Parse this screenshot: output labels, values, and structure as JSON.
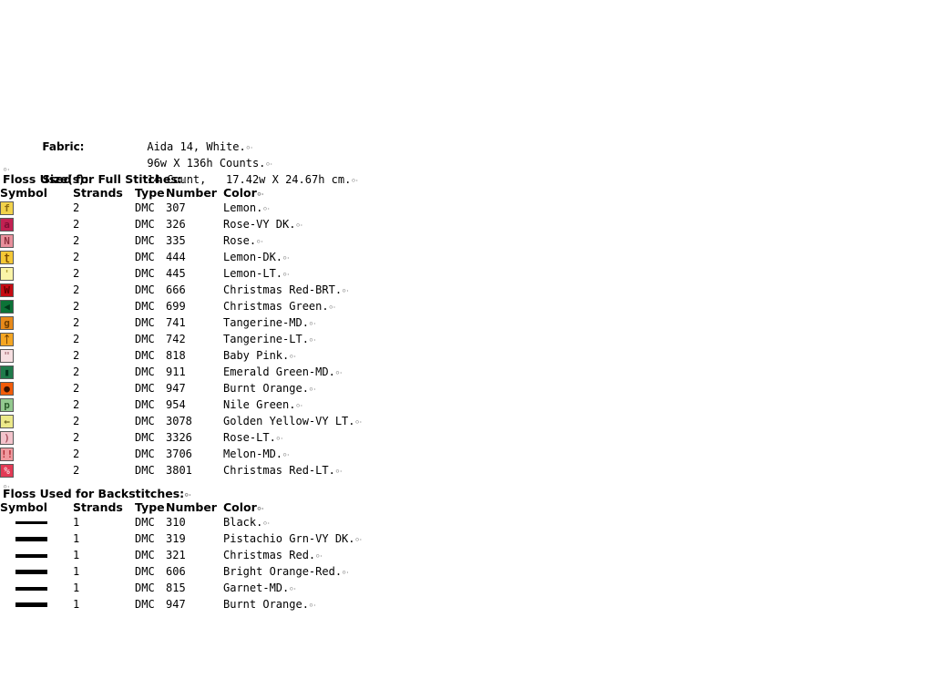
{
  "document": {
    "artifact_mark": "⸰⸱"
  },
  "spec": {
    "rows": [
      {
        "label": "Fabric:",
        "value": "Aida 14, White."
      },
      {
        "label": "",
        "value": "96w X 136h Counts."
      },
      {
        "label": "Size(s):",
        "value": "14 Count,   17.42w X 24.67h cm."
      }
    ]
  },
  "full_stitches": {
    "title": "Floss Used for Full Stitches:",
    "headers": {
      "symbol": "Symbol",
      "strands": "Strands",
      "type": "Type",
      "number": "Number",
      "color": "Color"
    },
    "rows": [
      {
        "glyph": "f",
        "swatch_bg": "#f2d24b",
        "glyph_color": "#8a6a12",
        "strands": "2",
        "type": "DMC",
        "number": "307",
        "color": "Lemon."
      },
      {
        "glyph": "a",
        "swatch_bg": "#c22152",
        "glyph_color": "#7e0e33",
        "strands": "2",
        "type": "DMC",
        "number": "326",
        "color": "Rose-VY DK."
      },
      {
        "glyph": "N",
        "swatch_bg": "#e8909c",
        "glyph_color": "#8c2f3d",
        "strands": "2",
        "type": "DMC",
        "number": "335",
        "color": "Rose."
      },
      {
        "glyph": "ʈ",
        "swatch_bg": "#f5c836",
        "glyph_color": "#7a4a00",
        "strands": "2",
        "type": "DMC",
        "number": "444",
        "color": "Lemon-DK."
      },
      {
        "glyph": "'",
        "swatch_bg": "#fbf5a8",
        "glyph_color": "#b5a23a",
        "strands": "2",
        "type": "DMC",
        "number": "445",
        "color": "Lemon-LT."
      },
      {
        "glyph": "W",
        "swatch_bg": "#c60b13",
        "glyph_color": "#5e0000",
        "strands": "2",
        "type": "DMC",
        "number": "666",
        "color": "Christmas Red-BRT."
      },
      {
        "glyph": "◀",
        "swatch_bg": "#0c7337",
        "glyph_color": "#00391a",
        "strands": "2",
        "type": "DMC",
        "number": "699",
        "color": "Christmas Green."
      },
      {
        "glyph": "g",
        "swatch_bg": "#e88a1a",
        "glyph_color": "#6d3c00",
        "strands": "2",
        "type": "DMC",
        "number": "741",
        "color": "Tangerine-MD."
      },
      {
        "glyph": "ᛏ",
        "swatch_bg": "#f5a623",
        "glyph_color": "#6d3c00",
        "strands": "2",
        "type": "DMC",
        "number": "742",
        "color": "Tangerine-LT."
      },
      {
        "glyph": "\"",
        "swatch_bg": "#f6dfe1",
        "glyph_color": "#b07a82",
        "strands": "2",
        "type": "DMC",
        "number": "818",
        "color": "Baby Pink."
      },
      {
        "glyph": "▮",
        "swatch_bg": "#1f7a4a",
        "glyph_color": "#00331c",
        "strands": "2",
        "type": "DMC",
        "number": "911",
        "color": "Emerald Green-MD."
      },
      {
        "glyph": "●",
        "swatch_bg": "#f25c0a",
        "glyph_color": "#3a1200",
        "strands": "2",
        "type": "DMC",
        "number": "947",
        "color": "Burnt Orange."
      },
      {
        "glyph": "p",
        "swatch_bg": "#93c98f",
        "glyph_color": "#2b5c2b",
        "strands": "2",
        "type": "DMC",
        "number": "954",
        "color": "Nile Green."
      },
      {
        "glyph": "←",
        "swatch_bg": "#ece98a",
        "glyph_color": "#6b6420",
        "strands": "2",
        "type": "DMC",
        "number": "3078",
        "color": "Golden Yellow-VY LT."
      },
      {
        "glyph": ")",
        "swatch_bg": "#f3c4cc",
        "glyph_color": "#a8505f",
        "strands": "2",
        "type": "DMC",
        "number": "3326",
        "color": "Rose-LT."
      },
      {
        "glyph": "!!",
        "swatch_bg": "#f09a9f",
        "glyph_color": "#b02b35",
        "strands": "2",
        "type": "DMC",
        "number": "3706",
        "color": "Melon-MD."
      },
      {
        "glyph": "%",
        "swatch_bg": "#e23a55",
        "glyph_color": "#f2c9cf",
        "strands": "2",
        "type": "DMC",
        "number": "3801",
        "color": "Christmas Red-LT."
      }
    ]
  },
  "backstitches": {
    "title": "Floss Used for Backstitches:",
    "headers": {
      "symbol": "Symbol",
      "strands": "Strands",
      "type": "Type",
      "number": "Number",
      "color": "Color"
    },
    "rows": [
      {
        "line_thickness": "3px",
        "strands": "1",
        "type": "DMC",
        "number": "310",
        "color": "Black."
      },
      {
        "line_thickness": "5px",
        "strands": "1",
        "type": "DMC",
        "number": "319",
        "color": "Pistachio Grn-VY DK."
      },
      {
        "line_thickness": "4px",
        "strands": "1",
        "type": "DMC",
        "number": "321",
        "color": "Christmas Red."
      },
      {
        "line_thickness": "5px",
        "strands": "1",
        "type": "DMC",
        "number": "606",
        "color": "Bright Orange-Red."
      },
      {
        "line_thickness": "4px",
        "strands": "1",
        "type": "DMC",
        "number": "815",
        "color": "Garnet-MD."
      },
      {
        "line_thickness": "5px",
        "strands": "1",
        "type": "DMC",
        "number": "947",
        "color": "Burnt Orange."
      }
    ]
  }
}
